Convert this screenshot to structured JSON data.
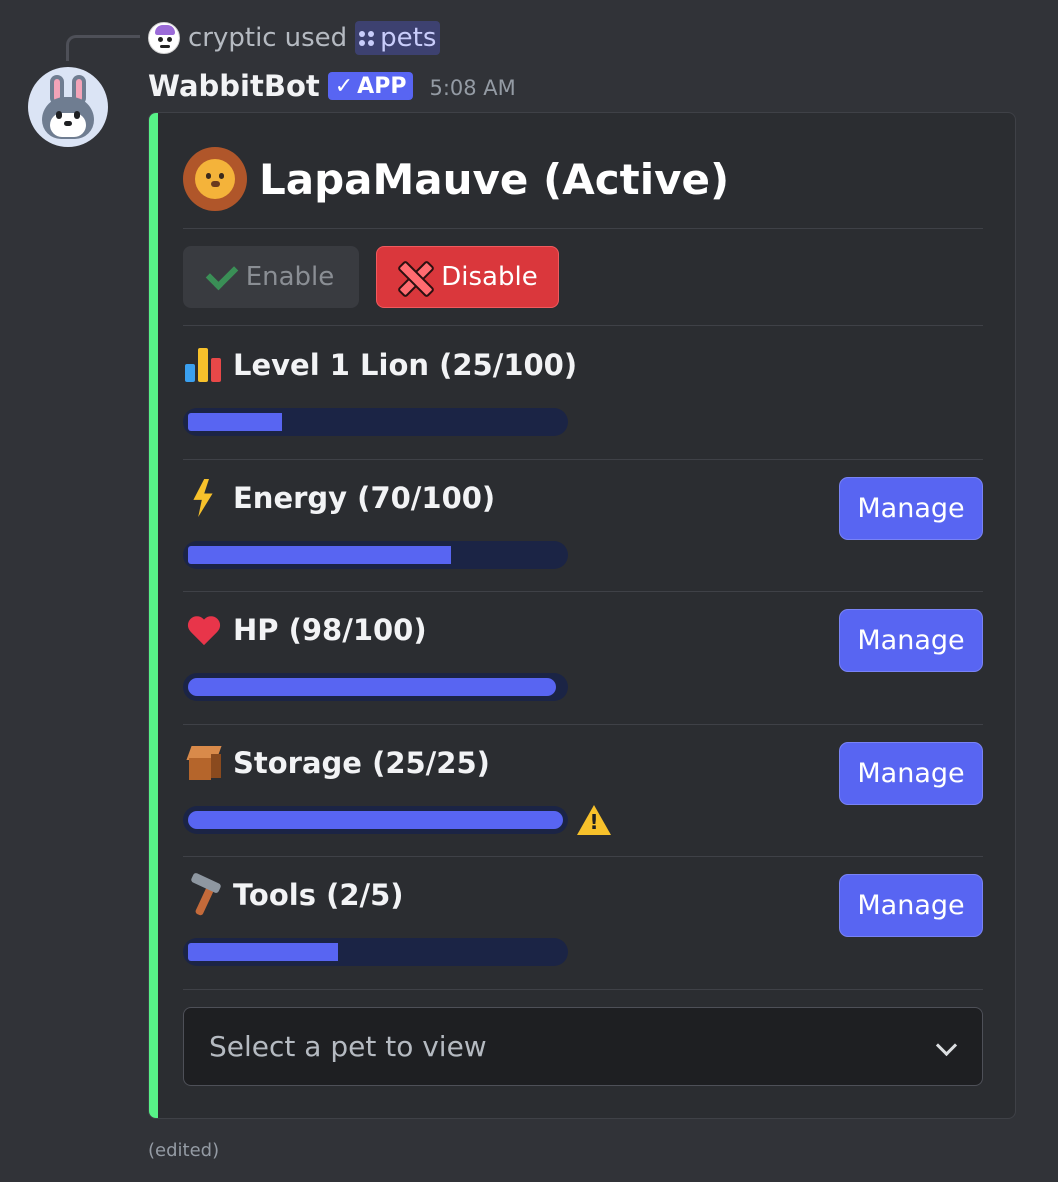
{
  "reply": {
    "user": "cryptic",
    "verb": "used",
    "command": "pets"
  },
  "message": {
    "author": "WabbitBot",
    "app_tag": "APP",
    "time": "5:08 AM",
    "edited": "(edited)"
  },
  "embed": {
    "accent_color": "#57f287",
    "title": "LapaMauve (Active)",
    "title_icon": "lion-face-icon",
    "buttons": {
      "enable": "Enable",
      "disable": "Disable"
    },
    "stats": [
      {
        "icon": "bar-chart-icon",
        "label": "Level 1 Lion (25/100)",
        "value": 25,
        "max": 100,
        "has_manage": false,
        "warning": false
      },
      {
        "icon": "lightning-icon",
        "label": "Energy (70/100)",
        "value": 70,
        "max": 100,
        "has_manage": true,
        "warning": false
      },
      {
        "icon": "heart-icon",
        "label": "HP (98/100)",
        "value": 98,
        "max": 100,
        "has_manage": true,
        "warning": false
      },
      {
        "icon": "box-icon",
        "label": "Storage (25/25)",
        "value": 25,
        "max": 25,
        "has_manage": true,
        "warning": true
      },
      {
        "icon": "hammer-icon",
        "label": "Tools (2/5)",
        "value": 2,
        "max": 5,
        "has_manage": true,
        "warning": false
      }
    ],
    "manage_label": "Manage",
    "select_placeholder": "Select a pet to view"
  },
  "colors": {
    "blurple": "#5865f2",
    "danger": "#da373c",
    "bar_track": "#1b2445",
    "background": "#313338",
    "embed_bg": "#2b2d31"
  }
}
